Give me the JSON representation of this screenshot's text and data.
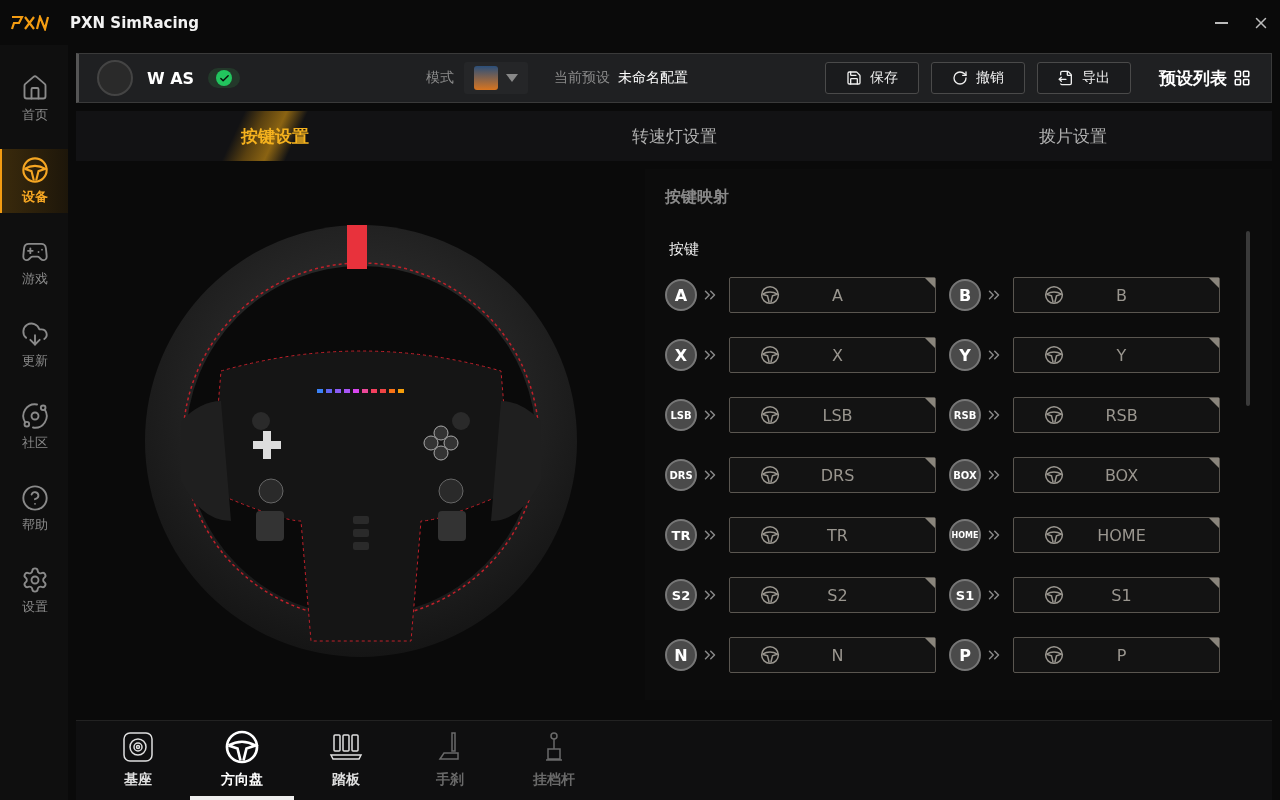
{
  "window": {
    "title": "PXN SimRacing"
  },
  "sidebar": {
    "items": [
      {
        "label": "首页",
        "kind": "home",
        "selected": false
      },
      {
        "label": "设备",
        "kind": "device",
        "selected": true
      },
      {
        "label": "游戏",
        "kind": "game",
        "selected": false
      },
      {
        "label": "更新",
        "kind": "update",
        "selected": false
      },
      {
        "label": "社区",
        "kind": "community",
        "selected": false
      },
      {
        "label": "帮助",
        "kind": "help",
        "selected": false
      },
      {
        "label": "设置",
        "kind": "settings",
        "selected": false
      }
    ]
  },
  "header": {
    "device_name": "W AS",
    "connected": true,
    "mode_label": "模式",
    "preset_label": "当前预设",
    "preset_value": "未命名配置",
    "buttons": [
      {
        "label": "保存",
        "kind": "save"
      },
      {
        "label": "撤销",
        "kind": "undo"
      },
      {
        "label": "导出",
        "kind": "export"
      }
    ],
    "preset_list": "预设列表"
  },
  "tabs": [
    {
      "label": "按键设置",
      "selected": true
    },
    {
      "label": "转速灯设置",
      "selected": false
    },
    {
      "label": "拨片设置",
      "selected": false
    }
  ],
  "mapping": {
    "title": "按键映射",
    "section": "按键",
    "items": [
      {
        "key": "A",
        "value": "A"
      },
      {
        "key": "B",
        "value": "B"
      },
      {
        "key": "X",
        "value": "X"
      },
      {
        "key": "Y",
        "value": "Y"
      },
      {
        "key": "LSB",
        "value": "LSB"
      },
      {
        "key": "RSB",
        "value": "RSB"
      },
      {
        "key": "DRS",
        "value": "DRS"
      },
      {
        "key": "BOX",
        "value": "BOX"
      },
      {
        "key": "TR",
        "value": "TR"
      },
      {
        "key": "HOME",
        "value": "HOME"
      },
      {
        "key": "S2",
        "value": "S2"
      },
      {
        "key": "S1",
        "value": "S1"
      },
      {
        "key": "N",
        "value": "N"
      },
      {
        "key": "P",
        "value": "P"
      }
    ]
  },
  "devices": [
    {
      "label": "基座",
      "kind": "base",
      "selected": false,
      "disabled": false
    },
    {
      "label": "方向盘",
      "kind": "wheel",
      "selected": true,
      "disabled": false
    },
    {
      "label": "踏板",
      "kind": "pedals",
      "selected": false,
      "disabled": false
    },
    {
      "label": "手刹",
      "kind": "handbrake",
      "selected": false,
      "disabled": true
    },
    {
      "label": "挂档杆",
      "kind": "shifter",
      "selected": false,
      "disabled": true
    }
  ]
}
